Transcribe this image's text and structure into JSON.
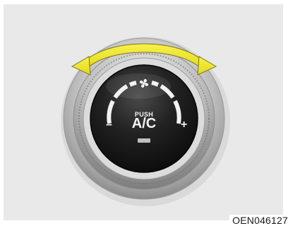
{
  "control": {
    "push_label": "PUSH",
    "main_label": "A/C",
    "decrease_symbol": "–",
    "increase_symbol": "+",
    "indicator_icon": "fan-icon",
    "rotation_indicator": "double-arrow-icon"
  },
  "caption": {
    "code": "OEN046127"
  },
  "colors": {
    "arrow": "#f2ea2c",
    "knob_face": "#1c1c1c",
    "bezel": "#c8c8c8",
    "background": "#e9e9e9"
  }
}
